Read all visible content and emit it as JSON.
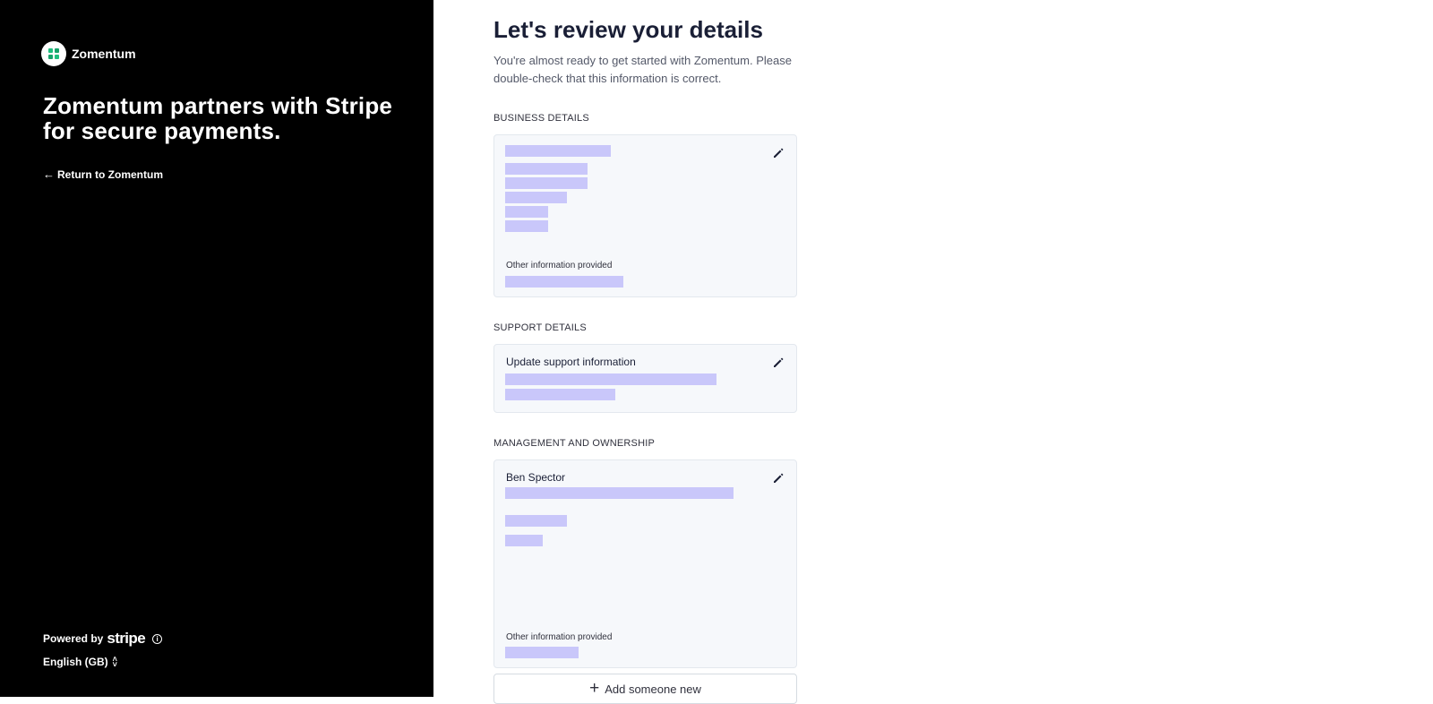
{
  "brand": {
    "name": "Zomentum",
    "logo_icon": "zomentum-logo-icon",
    "accent_color": "#1fbf7f"
  },
  "sidebar": {
    "title": "Zomentum partners with Stripe for secure payments.",
    "return_link": "Return to Zomentum",
    "powered_by": "Powered by",
    "stripe_label": "stripe",
    "language": "English (GB)"
  },
  "page": {
    "title": "Let's review your details",
    "subtitle": "You're almost ready to get started with Zomentum. Please double-check that this information is correct."
  },
  "sections": {
    "business": {
      "label": "BUSINESS DETAILS",
      "other_info": "Other information provided"
    },
    "support": {
      "label": "SUPPORT DETAILS",
      "update_label": "Update support information"
    },
    "management": {
      "label": "MANAGEMENT AND OWNERSHIP",
      "person_name": "Ben Spector",
      "other_info": "Other information provided"
    }
  },
  "add_button": {
    "label": "Add someone new"
  },
  "colors": {
    "redaction": "#c9c7fa",
    "card_bg": "#f6f8fb",
    "sidebar_bg": "#000000"
  }
}
